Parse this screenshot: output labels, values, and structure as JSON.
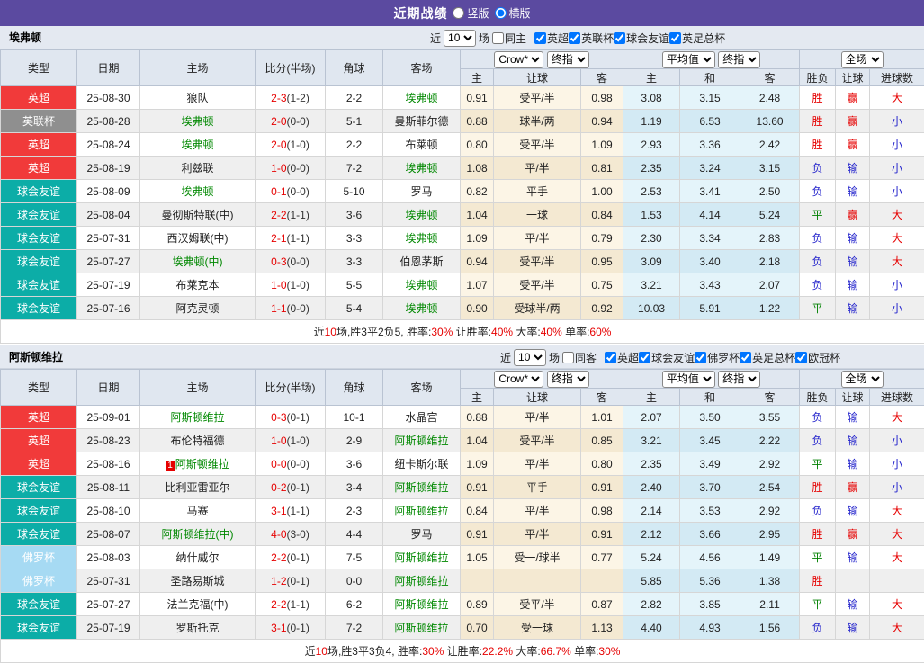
{
  "header": {
    "title": "近期战绩",
    "vertical_label": "竖版",
    "horizontal_label": "横版"
  },
  "table_header": {
    "cols": [
      "类型",
      "日期",
      "主场",
      "比分(半场)",
      "角球",
      "客场"
    ],
    "odds_company": "Crow*",
    "odds_stage": "终指",
    "avg_company": "平均值",
    "avg_stage": "终指",
    "scope": "全场",
    "sub": [
      "主",
      "让球",
      "客",
      "主",
      "和",
      "客",
      "胜负",
      "让球",
      "进球数"
    ]
  },
  "palette": {
    "league": {
      "英超": "#f13a3a",
      "英联杯": "#8f8f8f",
      "球会友谊": "#0cada7",
      "佛罗杯": "#a6daf3",
      "英足总杯": "#f13a3a",
      "欧冠杯": "#3a6bd6"
    },
    "result": {
      "red": "#e60000",
      "green": "#008000",
      "blue": "#2424cc"
    },
    "team_highlight": "#008800",
    "score": "#e60000",
    "plain_team": "#222222"
  },
  "sections": [
    {
      "team": "埃弗顿",
      "filter": {
        "near": "近",
        "count": "10",
        "games": "场",
        "same": "同主",
        "leagues": [
          "英超",
          "英联杯",
          "球会友谊",
          "英足总杯"
        ]
      },
      "rows": [
        {
          "type": "英超",
          "date": "25-08-30",
          "home": "狼队",
          "hg": false,
          "ft": "2-3",
          "ht": "(1-2)",
          "corner": "2-2",
          "away": "埃弗顿",
          "ag": true,
          "h": "0.91",
          "hc": "受平/半",
          "a": "0.98",
          "m1": "3.08",
          "m2": "3.15",
          "m3": "2.48",
          "r1": "胜",
          "c1": "red",
          "r2": "赢",
          "c2": "red",
          "r3": "大",
          "c3": "red"
        },
        {
          "type": "英联杯",
          "date": "25-08-28",
          "home": "埃弗顿",
          "hg": true,
          "ft": "2-0",
          "ht": "(0-0)",
          "corner": "5-1",
          "away": "曼斯菲尔德",
          "ag": false,
          "h": "0.88",
          "hc": "球半/两",
          "a": "0.94",
          "m1": "1.19",
          "m2": "6.53",
          "m3": "13.60",
          "r1": "胜",
          "c1": "red",
          "r2": "赢",
          "c2": "red",
          "r3": "小",
          "c3": "blue"
        },
        {
          "type": "英超",
          "date": "25-08-24",
          "home": "埃弗顿",
          "hg": true,
          "ft": "2-0",
          "ht": "(1-0)",
          "corner": "2-2",
          "away": "布莱顿",
          "ag": false,
          "h": "0.80",
          "hc": "受平/半",
          "a": "1.09",
          "m1": "2.93",
          "m2": "3.36",
          "m3": "2.42",
          "r1": "胜",
          "c1": "red",
          "r2": "赢",
          "c2": "red",
          "r3": "小",
          "c3": "blue"
        },
        {
          "type": "英超",
          "date": "25-08-19",
          "home": "利兹联",
          "hg": false,
          "ft": "1-0",
          "ht": "(0-0)",
          "corner": "7-2",
          "away": "埃弗顿",
          "ag": true,
          "h": "1.08",
          "hc": "平/半",
          "a": "0.81",
          "m1": "2.35",
          "m2": "3.24",
          "m3": "3.15",
          "r1": "负",
          "c1": "blue",
          "r2": "输",
          "c2": "blue",
          "r3": "小",
          "c3": "blue"
        },
        {
          "type": "球会友谊",
          "date": "25-08-09",
          "home": "埃弗顿",
          "hg": true,
          "ft": "0-1",
          "ht": "(0-0)",
          "corner": "5-10",
          "away": "罗马",
          "ag": false,
          "h": "0.82",
          "hc": "平手",
          "a": "1.00",
          "m1": "2.53",
          "m2": "3.41",
          "m3": "2.50",
          "r1": "负",
          "c1": "blue",
          "r2": "输",
          "c2": "blue",
          "r3": "小",
          "c3": "blue"
        },
        {
          "type": "球会友谊",
          "date": "25-08-04",
          "home": "曼彻斯特联(中)",
          "hg": false,
          "ft": "2-2",
          "ht": "(1-1)",
          "corner": "3-6",
          "away": "埃弗顿",
          "ag": true,
          "h": "1.04",
          "hc": "一球",
          "a": "0.84",
          "m1": "1.53",
          "m2": "4.14",
          "m3": "5.24",
          "r1": "平",
          "c1": "green",
          "r2": "赢",
          "c2": "red",
          "r3": "大",
          "c3": "red"
        },
        {
          "type": "球会友谊",
          "date": "25-07-31",
          "home": "西汉姆联(中)",
          "hg": false,
          "ft": "2-1",
          "ht": "(1-1)",
          "corner": "3-3",
          "away": "埃弗顿",
          "ag": true,
          "h": "1.09",
          "hc": "平/半",
          "a": "0.79",
          "m1": "2.30",
          "m2": "3.34",
          "m3": "2.83",
          "r1": "负",
          "c1": "blue",
          "r2": "输",
          "c2": "blue",
          "r3": "大",
          "c3": "red"
        },
        {
          "type": "球会友谊",
          "date": "25-07-27",
          "home": "埃弗顿(中)",
          "hg": true,
          "ft": "0-3",
          "ht": "(0-0)",
          "corner": "3-3",
          "away": "伯恩茅斯",
          "ag": false,
          "h": "0.94",
          "hc": "受平/半",
          "a": "0.95",
          "m1": "3.09",
          "m2": "3.40",
          "m3": "2.18",
          "r1": "负",
          "c1": "blue",
          "r2": "输",
          "c2": "blue",
          "r3": "大",
          "c3": "red"
        },
        {
          "type": "球会友谊",
          "date": "25-07-19",
          "home": "布莱克本",
          "hg": false,
          "ft": "1-0",
          "ht": "(1-0)",
          "corner": "5-5",
          "away": "埃弗顿",
          "ag": true,
          "h": "1.07",
          "hc": "受平/半",
          "a": "0.75",
          "m1": "3.21",
          "m2": "3.43",
          "m3": "2.07",
          "r1": "负",
          "c1": "blue",
          "r2": "输",
          "c2": "blue",
          "r3": "小",
          "c3": "blue"
        },
        {
          "type": "球会友谊",
          "date": "25-07-16",
          "home": "阿克灵顿",
          "hg": false,
          "ft": "1-1",
          "ht": "(0-0)",
          "corner": "5-4",
          "away": "埃弗顿",
          "ag": true,
          "h": "0.90",
          "hc": "受球半/两",
          "a": "0.92",
          "m1": "10.03",
          "m2": "5.91",
          "m3": "1.22",
          "r1": "平",
          "c1": "green",
          "r2": "输",
          "c2": "blue",
          "r3": "小",
          "c3": "blue"
        }
      ],
      "summary": [
        {
          "t": "近",
          "c": "k"
        },
        {
          "t": "10",
          "c": "r"
        },
        {
          "t": "场,胜3平2负5, 胜率:",
          "c": "k"
        },
        {
          "t": "30%",
          "c": "r"
        },
        {
          "t": " 让胜率:",
          "c": "k"
        },
        {
          "t": "40%",
          "c": "r"
        },
        {
          "t": " 大率:",
          "c": "k"
        },
        {
          "t": "40%",
          "c": "r"
        },
        {
          "t": " 单率:",
          "c": "k"
        },
        {
          "t": "60%",
          "c": "r"
        }
      ]
    },
    {
      "team": "阿斯顿维拉",
      "filter": {
        "near": "近",
        "count": "10",
        "games": "场",
        "same": "同客",
        "leagues": [
          "英超",
          "球会友谊",
          "佛罗杯",
          "英足总杯",
          "欧冠杯"
        ]
      },
      "rows": [
        {
          "type": "英超",
          "date": "25-09-01",
          "home": "阿斯顿维拉",
          "hg": true,
          "ft": "0-3",
          "ht": "(0-1)",
          "corner": "10-1",
          "away": "水晶宫",
          "ag": false,
          "h": "0.88",
          "hc": "平/半",
          "a": "1.01",
          "m1": "2.07",
          "m2": "3.50",
          "m3": "3.55",
          "r1": "负",
          "c1": "blue",
          "r2": "输",
          "c2": "blue",
          "r3": "大",
          "c3": "red"
        },
        {
          "type": "英超",
          "date": "25-08-23",
          "home": "布伦特福德",
          "hg": false,
          "ft": "1-0",
          "ht": "(1-0)",
          "corner": "2-9",
          "away": "阿斯顿维拉",
          "ag": true,
          "h": "1.04",
          "hc": "受平/半",
          "a": "0.85",
          "m1": "3.21",
          "m2": "3.45",
          "m3": "2.22",
          "r1": "负",
          "c1": "blue",
          "r2": "输",
          "c2": "blue",
          "r3": "小",
          "c3": "blue"
        },
        {
          "type": "英超",
          "date": "25-08-16",
          "home": "阿斯顿维拉",
          "hg": true,
          "home_badge": "1",
          "ft": "0-0",
          "ht": "(0-0)",
          "corner": "3-6",
          "away": "纽卡斯尔联",
          "ag": false,
          "h": "1.09",
          "hc": "平/半",
          "a": "0.80",
          "m1": "2.35",
          "m2": "3.49",
          "m3": "2.92",
          "r1": "平",
          "c1": "green",
          "r2": "输",
          "c2": "blue",
          "r3": "小",
          "c3": "blue"
        },
        {
          "type": "球会友谊",
          "date": "25-08-11",
          "home": "比利亚雷亚尔",
          "hg": false,
          "ft": "0-2",
          "ht": "(0-1)",
          "corner": "3-4",
          "away": "阿斯顿维拉",
          "ag": true,
          "h": "0.91",
          "hc": "平手",
          "a": "0.91",
          "m1": "2.40",
          "m2": "3.70",
          "m3": "2.54",
          "r1": "胜",
          "c1": "red",
          "r2": "赢",
          "c2": "red",
          "r3": "小",
          "c3": "blue"
        },
        {
          "type": "球会友谊",
          "date": "25-08-10",
          "home": "马赛",
          "hg": false,
          "ft": "3-1",
          "ht": "(1-1)",
          "corner": "2-3",
          "away": "阿斯顿维拉",
          "ag": true,
          "h": "0.84",
          "hc": "平/半",
          "a": "0.98",
          "m1": "2.14",
          "m2": "3.53",
          "m3": "2.92",
          "r1": "负",
          "c1": "blue",
          "r2": "输",
          "c2": "blue",
          "r3": "大",
          "c3": "red"
        },
        {
          "type": "球会友谊",
          "date": "25-08-07",
          "home": "阿斯顿维拉(中)",
          "hg": true,
          "ft": "4-0",
          "ht": "(3-0)",
          "corner": "4-4",
          "away": "罗马",
          "ag": false,
          "h": "0.91",
          "hc": "平/半",
          "a": "0.91",
          "m1": "2.12",
          "m2": "3.66",
          "m3": "2.95",
          "r1": "胜",
          "c1": "red",
          "r2": "赢",
          "c2": "red",
          "r3": "大",
          "c3": "red"
        },
        {
          "type": "佛罗杯",
          "date": "25-08-03",
          "home": "纳什威尔",
          "hg": false,
          "ft": "2-2",
          "ht": "(0-1)",
          "corner": "7-5",
          "away": "阿斯顿维拉",
          "ag": true,
          "h": "1.05",
          "hc": "受一/球半",
          "a": "0.77",
          "m1": "5.24",
          "m2": "4.56",
          "m3": "1.49",
          "r1": "平",
          "c1": "green",
          "r2": "输",
          "c2": "blue",
          "r3": "大",
          "c3": "red"
        },
        {
          "type": "佛罗杯",
          "date": "25-07-31",
          "home": "圣路易斯城",
          "hg": false,
          "ft": "1-2",
          "ht": "(0-1)",
          "corner": "0-0",
          "away": "阿斯顿维拉",
          "ag": true,
          "h": "",
          "hc": "",
          "a": "",
          "m1": "5.85",
          "m2": "5.36",
          "m3": "1.38",
          "r1": "胜",
          "c1": "red",
          "r2": "",
          "c2": "",
          "r3": "",
          "c3": ""
        },
        {
          "type": "球会友谊",
          "date": "25-07-27",
          "home": "法兰克福(中)",
          "hg": false,
          "ft": "2-2",
          "ht": "(1-1)",
          "corner": "6-2",
          "away": "阿斯顿维拉",
          "ag": true,
          "h": "0.89",
          "hc": "受平/半",
          "a": "0.87",
          "m1": "2.82",
          "m2": "3.85",
          "m3": "2.11",
          "r1": "平",
          "c1": "green",
          "r2": "输",
          "c2": "blue",
          "r3": "大",
          "c3": "red"
        },
        {
          "type": "球会友谊",
          "date": "25-07-19",
          "home": "罗斯托克",
          "hg": false,
          "ft": "3-1",
          "ht": "(0-1)",
          "corner": "7-2",
          "away": "阿斯顿维拉",
          "ag": true,
          "h": "0.70",
          "hc": "受一球",
          "a": "1.13",
          "m1": "4.40",
          "m2": "4.93",
          "m3": "1.56",
          "r1": "负",
          "c1": "blue",
          "r2": "输",
          "c2": "blue",
          "r3": "大",
          "c3": "red"
        }
      ],
      "summary": [
        {
          "t": "近",
          "c": "k"
        },
        {
          "t": "10",
          "c": "r"
        },
        {
          "t": "场,胜3平3负4, 胜率:",
          "c": "k"
        },
        {
          "t": "30%",
          "c": "r"
        },
        {
          "t": " 让胜率:",
          "c": "k"
        },
        {
          "t": "22.2%",
          "c": "r"
        },
        {
          "t": " 大率:",
          "c": "k"
        },
        {
          "t": "66.7%",
          "c": "r"
        },
        {
          "t": " 单率:",
          "c": "k"
        },
        {
          "t": "30%",
          "c": "r"
        }
      ]
    }
  ]
}
